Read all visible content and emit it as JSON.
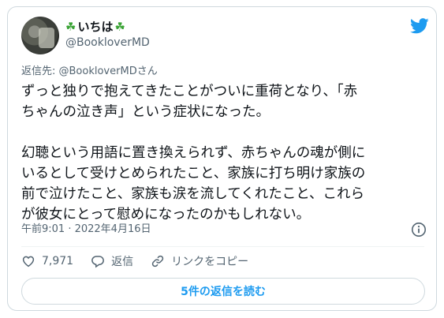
{
  "author": {
    "display_name": "いちは",
    "handle": "@BookloverMD"
  },
  "icons": {
    "brand": "twitter-bird-icon",
    "name_decoration": "four-leaf-clover-icon"
  },
  "colors": {
    "accent": "#1d9bf0",
    "clover": "#3aa335",
    "muted": "#536471",
    "border": "#cfd9de"
  },
  "reply_context": {
    "label": "返信先: ",
    "mention": "@BookloverMDさん"
  },
  "body": {
    "line1": "ずっと独りで抱えてきたことがついに重荷となり、「赤",
    "line2": "ちゃんの泣き声」という症状になった。",
    "line3": "",
    "line4": "幻聴という用語に置き換えられず、赤ちゃんの魂が側に",
    "line5": "いるとして受けとめられたこと、家族に打ち明け家族の",
    "line6": "前で泣けたこと、家族も涙を流してくれたこと、これら",
    "line7": "が彼女にとって慰めになったのかもしれない。"
  },
  "timestamp": "午前9:01 · 2022年4月16日",
  "actions": {
    "likes_count": "7,971",
    "reply_label": "返信",
    "copy_link_label": "リンクをコピー"
  },
  "replies_button_label": "5件の返信を読む"
}
